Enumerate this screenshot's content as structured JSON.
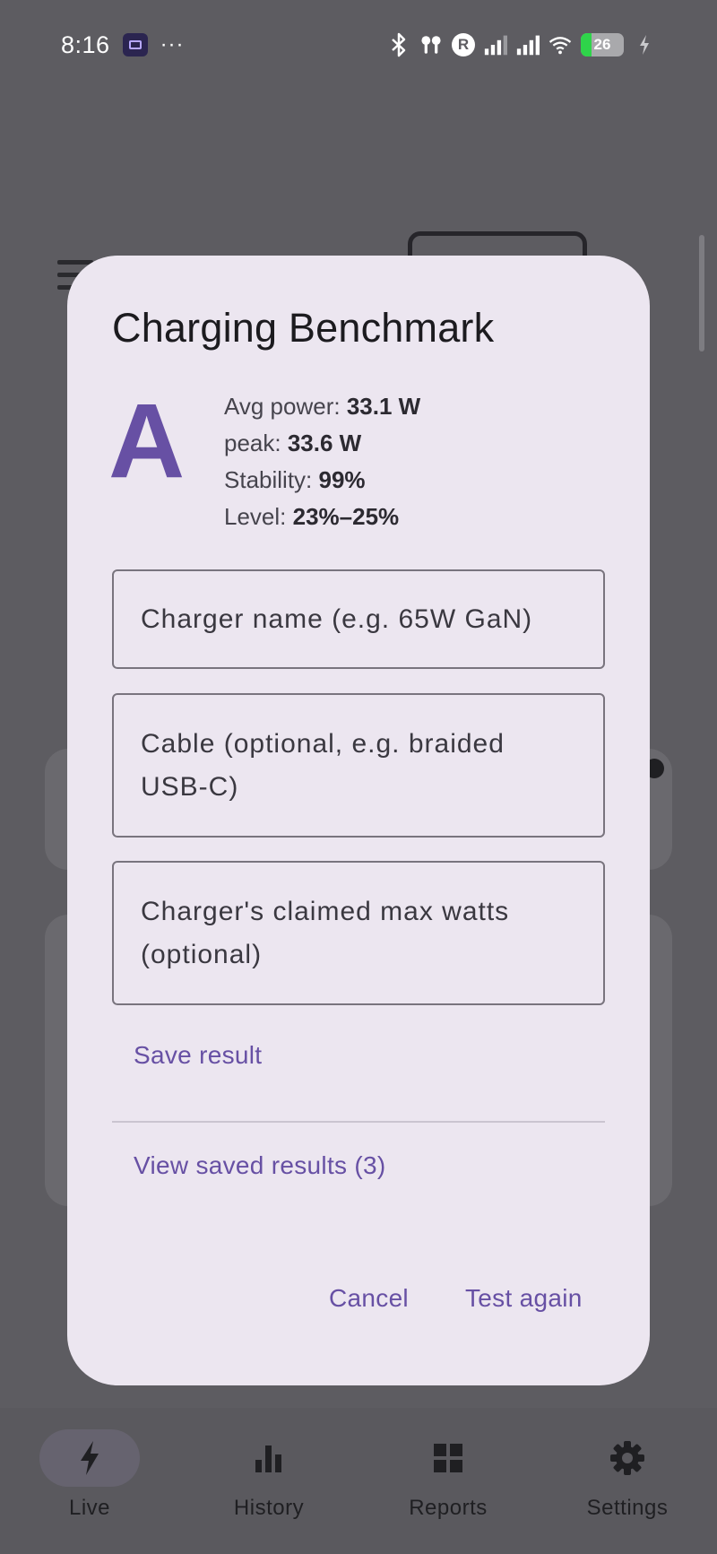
{
  "status_bar": {
    "time": "8:16",
    "dots": "···",
    "r_badge": "R",
    "battery_level": "26",
    "battery_fraction": 0.26,
    "icons": [
      "app-icon",
      "bluetooth-icon",
      "earbuds-icon",
      "signal-icon",
      "signal-icon",
      "wifi-icon",
      "charging-icon"
    ]
  },
  "dialog": {
    "title": "Charging Benchmark",
    "grade": "A",
    "stats": {
      "avg_label": "Avg power: ",
      "avg_value": "33.1 W",
      "peak_label": "peak: ",
      "peak_value": "33.6 W",
      "stability_label": "Stability: ",
      "stability_value": "99%",
      "level_label": "Level: ",
      "level_value": "23%–25%"
    },
    "fields": {
      "charger_placeholder": "Charger name (e.g. 65W GaN)",
      "cable_placeholder": "Cable (optional, e.g. braided USB-C)",
      "watts_placeholder": "Charger's claimed max watts (optional)"
    },
    "save_label": "Save result",
    "view_saved_label": "View saved results (3)",
    "cancel_label": "Cancel",
    "test_again_label": "Test again"
  },
  "bottom_nav": {
    "items": [
      {
        "label": "Live",
        "icon": "bolt-icon",
        "active": true
      },
      {
        "label": "History",
        "icon": "bar-chart-icon",
        "active": false
      },
      {
        "label": "Reports",
        "icon": "grid-icon",
        "active": false
      },
      {
        "label": "Settings",
        "icon": "gear-icon",
        "active": false
      }
    ]
  },
  "colors": {
    "accent": "#6750a4",
    "dialog_bg": "#ece6f0",
    "scrim": "#5d5c61"
  }
}
